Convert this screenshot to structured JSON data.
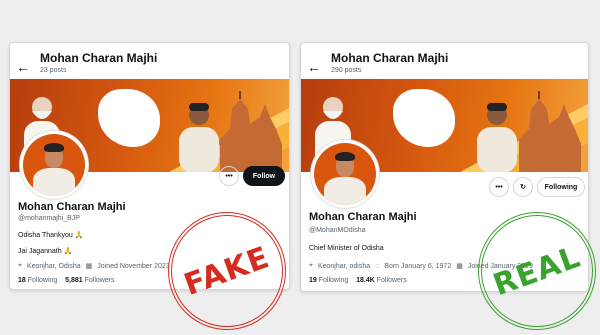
{
  "fake": {
    "name": "Mohan Charan Majhi",
    "posts": "23 posts",
    "profile_name": "Mohan Charan Majhi",
    "handle": "@mohanmajhi_BJP",
    "bio": "Odisha Thankyou 🙏",
    "bio2": "Jai Jagannath 🙏",
    "location": "Keonjhar, Odisha",
    "joined": "Joined November 2023",
    "following_count": "18",
    "following_label": "Following",
    "followers_count": "5,881",
    "followers_label": "Followers",
    "follow_button": "Follow",
    "stamp_word": "FAKE",
    "stamp_color": "#d62c1f"
  },
  "real": {
    "name": "Mohan Charan Majhi",
    "posts": "290 posts",
    "profile_name": "Mohan Charan Majhi",
    "handle": "@MohanMOdisha",
    "bio": "Chief Minister of Odisha",
    "location": "Keonjhar, odisha",
    "born": "Born January 6, 1972",
    "joined": "Joined January 2019",
    "following_count": "19",
    "following_label": "Following",
    "followers_count": "18.4K",
    "followers_label": "Followers",
    "follow_button": "Following",
    "stamp_word": "REAL",
    "stamp_color": "#3aa32f"
  },
  "icons": [
    "back-arrow-icon",
    "more-icon",
    "notify-icon",
    "location-icon",
    "calendar-icon",
    "balloon-icon"
  ]
}
